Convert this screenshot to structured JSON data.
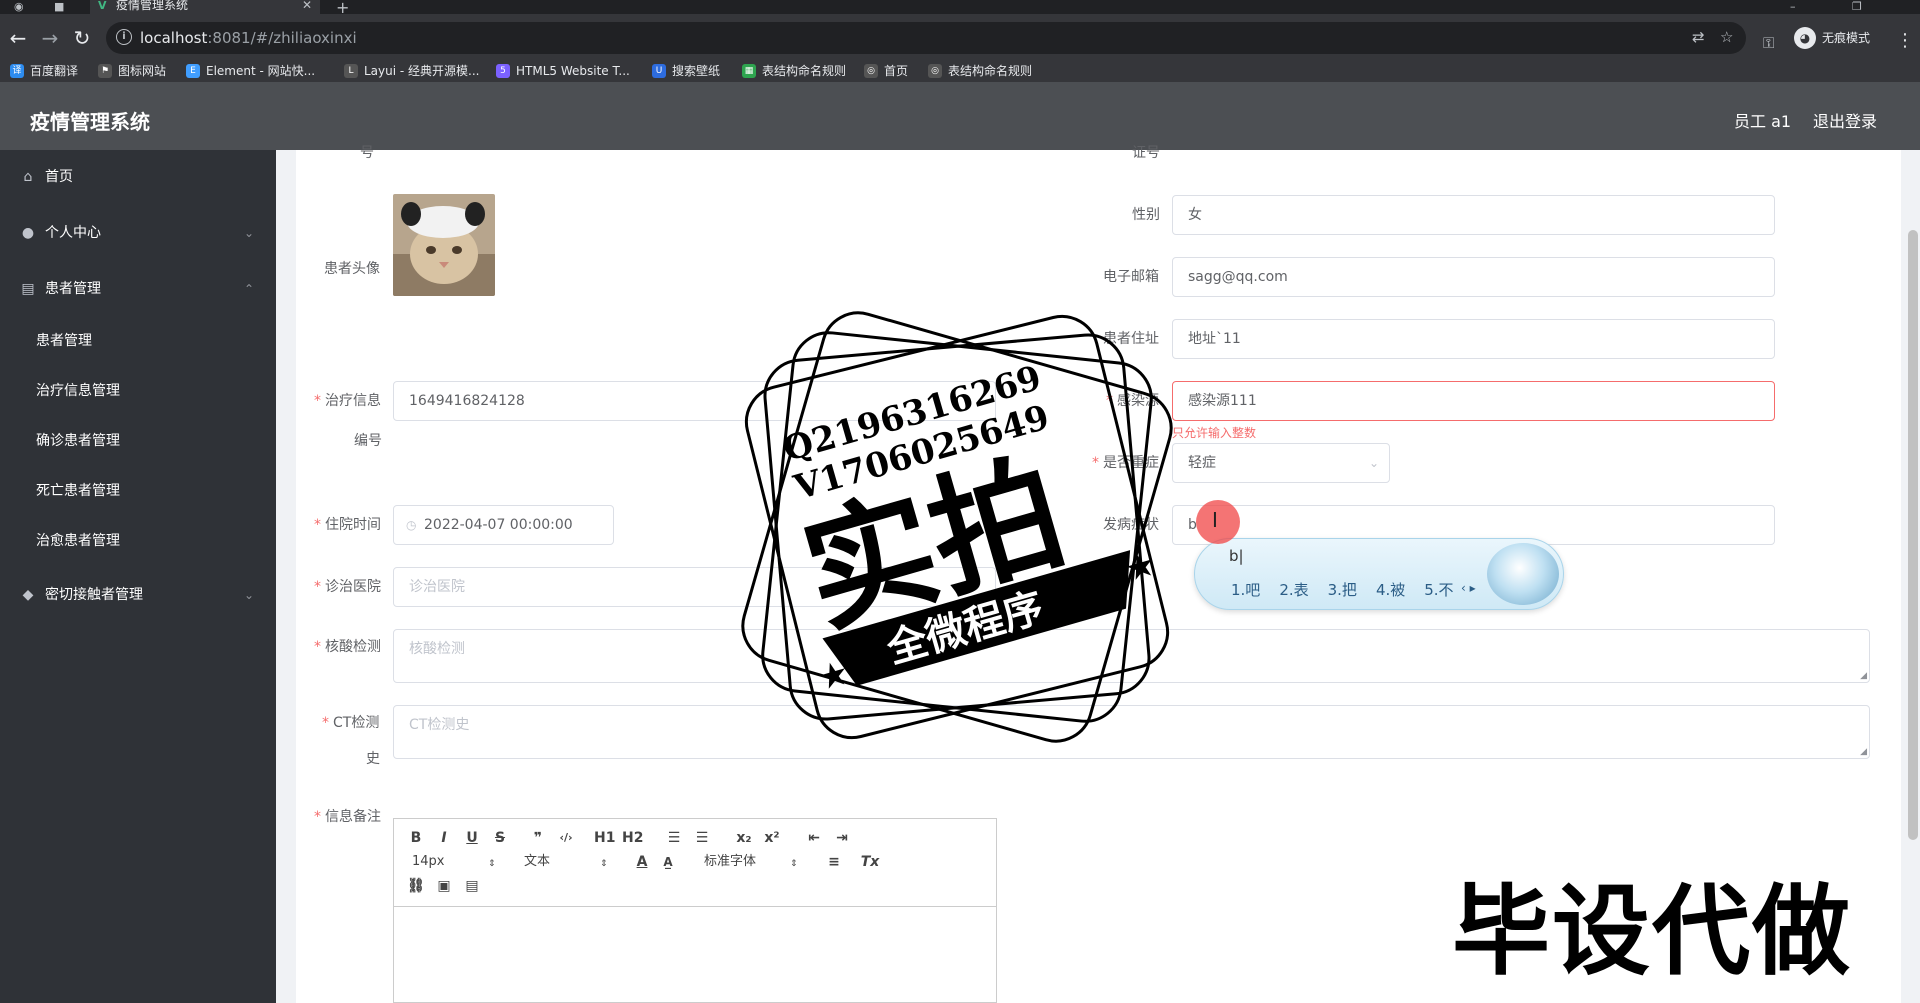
{
  "browser": {
    "tab_title": "疫情管理系统",
    "url_host": "localhost",
    "url_path": ":8081/#/zhiliaoxinxi",
    "profile_label": "无痕模式",
    "bookmarks": [
      {
        "label": "百度翻译",
        "color": "#2d8cf0"
      },
      {
        "label": "图标网站",
        "color": "#555555"
      },
      {
        "label": "Element - 网站快...",
        "color": "#409eff"
      },
      {
        "label": "Layui - 经典开源模...",
        "color": "#555555"
      },
      {
        "label": "HTML5 Website T...",
        "color": "#7b61ff"
      },
      {
        "label": "搜索壁纸",
        "color": "#2d6cdf"
      },
      {
        "label": "表结构命名规则",
        "color": "#2ea44f"
      },
      {
        "label": "首页",
        "color": "#555555"
      },
      {
        "label": "表结构命名规则",
        "color": "#555555"
      }
    ]
  },
  "header": {
    "title": "疫情管理系统",
    "user": "员工 a1",
    "logout": "退出登录"
  },
  "sidebar": {
    "items": [
      {
        "label": "首页",
        "icon": "home-icon"
      },
      {
        "label": "个人中心",
        "icon": "user-icon"
      },
      {
        "label": "患者管理",
        "icon": "clipboard-icon"
      },
      {
        "label": "密切接触者管理",
        "icon": "location-icon"
      }
    ],
    "sub_items": [
      "患者管理",
      "治疗信息管理",
      "确诊患者管理",
      "死亡患者管理",
      "治愈患者管理"
    ]
  },
  "form": {
    "top_left_label_fragment": "号",
    "top_right_label_fragment": "证号",
    "avatar_label": "患者头像",
    "gender_label": "性别",
    "gender_value": "女",
    "email_label": "电子邮箱",
    "email_value": "sagg@qq.com",
    "address_label": "患者住址",
    "address_value": "地址`11",
    "treat_no_label_1": "治疗信息",
    "treat_no_label_2": "编号",
    "treat_no_value": "1649416824128",
    "source_label": "感染源",
    "source_value": "感染源111",
    "source_error": "只允许输入整数",
    "severe_label": "是否重症",
    "severe_value": "轻症",
    "admit_label": "住院时间",
    "admit_value": "2022-04-07 00:00:00",
    "symptom_label": "发病症状",
    "symptom_value": "b",
    "hospital_label": "诊治医院",
    "hospital_placeholder": "诊治医院",
    "nucleic_label": "核酸检测",
    "nucleic_placeholder": "核酸检测",
    "ct_label_1": "CT检测",
    "ct_label_2": "史",
    "ct_placeholder": "CT检测史",
    "notes_label": "信息备注"
  },
  "editor": {
    "font_size": "14px",
    "text_style": "文本",
    "font_family": "标准字体",
    "buttons": [
      "B",
      "I",
      "U",
      "S",
      "❞",
      "‹/›",
      "H1",
      "H2",
      "ol",
      "ul",
      "x₂",
      "x²",
      "outdent",
      "indent",
      "align",
      "Tx",
      "link",
      "image",
      "video"
    ]
  },
  "ime": {
    "composition": "b|",
    "candidates": [
      "1.吧",
      "2.表",
      "3.把",
      "4.被",
      "5.不"
    ]
  },
  "watermarks": {
    "stamp_line1": "Q2196316269",
    "stamp_line2": "V1706025649",
    "stamp_big": "实拍",
    "stamp_banner": "全微程序",
    "bottom_text": "毕设代做"
  }
}
